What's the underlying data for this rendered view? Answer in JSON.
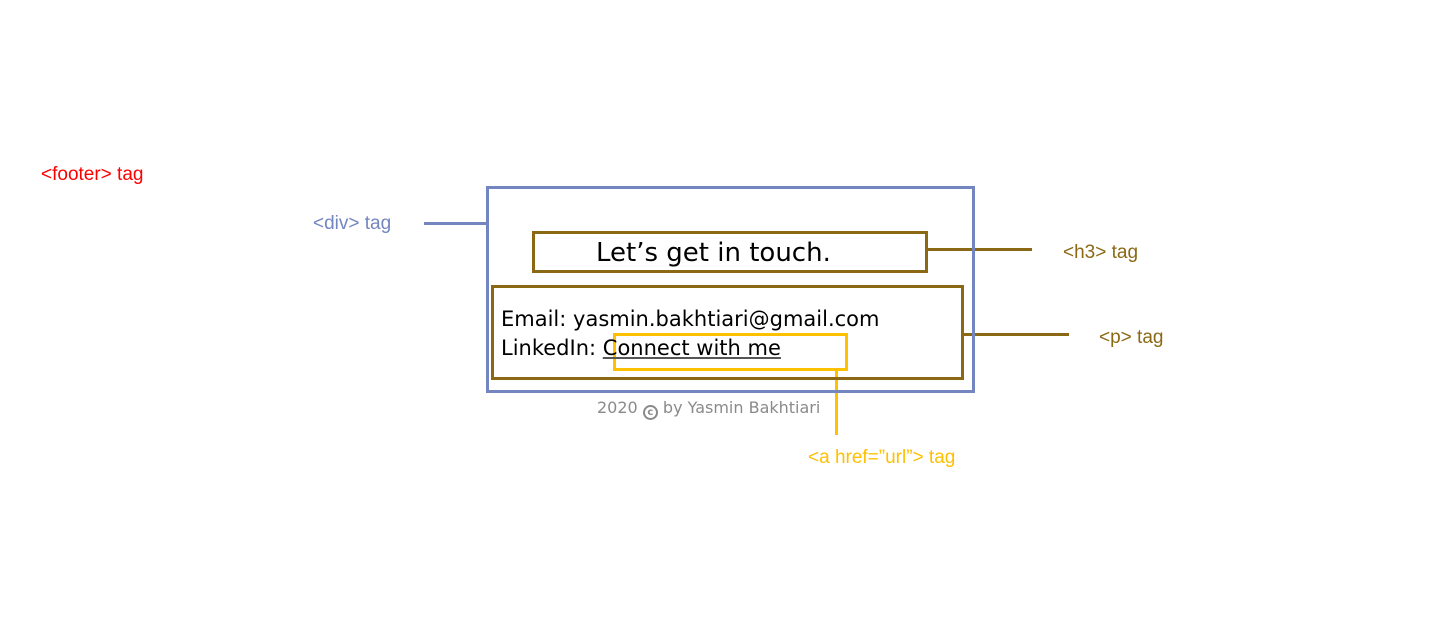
{
  "colors": {
    "footer": "#ff0000",
    "div": "#7386bf",
    "h3": "#8b6914",
    "p": "#8b6914",
    "a": "#ffc000",
    "copyright": "#8a8a8a"
  },
  "labels": {
    "footer": "<footer> tag",
    "div": "<div> tag",
    "h3": "<h3> tag",
    "p": "<p> tag",
    "a": "<a href=”url”> tag"
  },
  "content": {
    "heading": "Let’s get in touch.",
    "email_label": "Email",
    "email_value": "yasmin.bakhtiari@gmail.com",
    "linkedin_label": "LinkedIn",
    "linkedin_link": "Connect with me",
    "copyright_year": "2020",
    "copyright_icon": "copyright-icon",
    "copyright_by": "by Yasmin Bakhtiari"
  }
}
